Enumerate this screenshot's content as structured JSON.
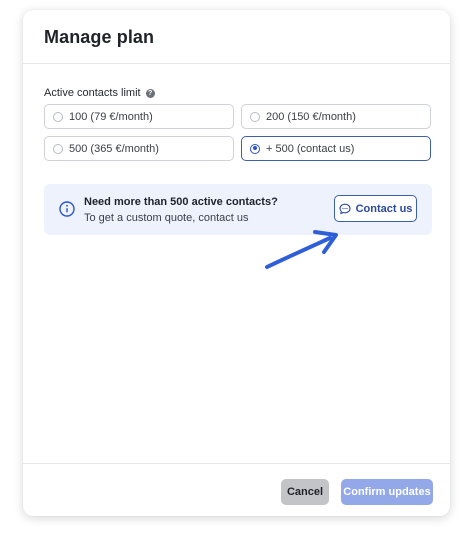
{
  "modal": {
    "title": "Manage plan"
  },
  "limit": {
    "label": "Active contacts limit",
    "help_icon": "question-circle-icon",
    "options": [
      {
        "label": "100 (79 €/month)",
        "selected": false
      },
      {
        "label": "200 (150 €/month)",
        "selected": false
      },
      {
        "label": "500 (365 €/month)",
        "selected": false
      },
      {
        "label": "+ 500 (contact us)",
        "selected": true
      }
    ]
  },
  "info": {
    "icon": "info-icon",
    "title": "Need more than 500 active contacts?",
    "subtitle": "To get a custom quote, contact us",
    "contact_button": {
      "label": "Contact us",
      "icon": "chat-bubble-icon"
    }
  },
  "annotation": {
    "icon": "pointer-arrow-icon",
    "color": "#2f5fd8"
  },
  "footer": {
    "cancel_label": "Cancel",
    "confirm_label": "Confirm updates"
  },
  "colors": {
    "accent": "#2b54c8",
    "info_bg": "#eef2fd",
    "confirm_disabled": "#93a8e8",
    "cancel_bg": "#c2c4c8"
  }
}
